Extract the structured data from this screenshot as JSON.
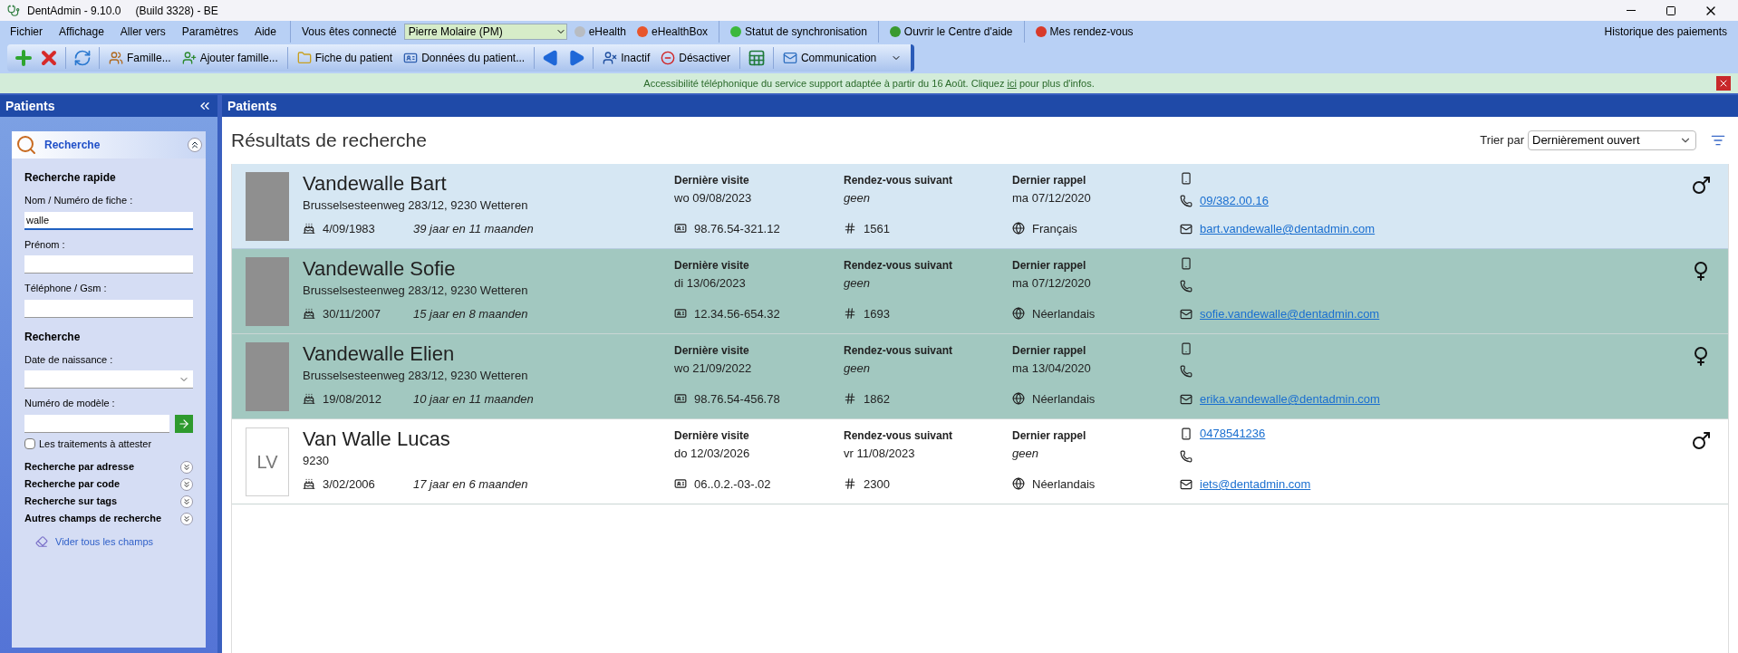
{
  "window": {
    "title": "DentAdmin - 9.10.0",
    "build": "(Build 3328) - BE"
  },
  "menu": {
    "items": [
      "Fichier",
      "Affichage",
      "Aller vers",
      "Paramètres",
      "Aide"
    ],
    "user_label": "Vous êtes connecté",
    "user": "Pierre Molaire (PM)",
    "status": [
      {
        "label": "eHealth",
        "color": "#b8bcc2"
      },
      {
        "label": "eHealthBox",
        "color": "#e8552c"
      },
      {
        "label": "Statut de synchronisation",
        "color": "#3cb83c"
      },
      {
        "label": "Ouvrir le Centre d'aide",
        "color": "#3a9a30"
      },
      {
        "label": "Mes rendez-vous",
        "color": "#d83a2a"
      }
    ],
    "right": "Historique des paiements"
  },
  "toolbar": {
    "buttons": [
      "Famille...",
      "Ajouter famille...",
      "Fiche du patient",
      "Données du patient...",
      "Inactif",
      "Désactiver",
      "Communication"
    ]
  },
  "notice": {
    "before": "Accessibilité téléphonique du service support adaptée à partir du 16 Août. Cliquez ",
    "link": "ici",
    "after": " pour plus d'infos."
  },
  "sidebar": {
    "title": "Patients",
    "section": {
      "title": "Recherche",
      "expanded": true
    },
    "quick_heading": "Recherche rapide",
    "quick_fields": [
      {
        "label": "Nom / Numéro de fiche :",
        "value": "walle",
        "focused": true
      },
      {
        "label": "Prénom :",
        "focused": false
      },
      {
        "label": "Téléphone / Gsm :",
        "focused": false
      }
    ],
    "search_heading": "Recherche",
    "birth_label": "Date de naissance :",
    "model_label": "Numéro de modèle :",
    "checkbox": {
      "label": "Les traitements à attester",
      "checked": false
    },
    "collapsed": [
      {
        "label": "Recherche par adresse",
        "expanded": false
      },
      {
        "label": "Recherche par code",
        "expanded": false
      },
      {
        "label": "Recherche sur tags",
        "expanded": false
      },
      {
        "label": "Autres champs de recherche",
        "expanded": false
      }
    ],
    "clear_link": "Vider tous les champs"
  },
  "main": {
    "header": "Patients",
    "title": "Résultats de recherche",
    "sort_label": "Trier par",
    "sort_value": "Dernièrement ouvert"
  },
  "patients": [
    {
      "name": "Vandewalle Bart",
      "address": "Brusselsesteenweg 283/12, 9230 Wetteren",
      "birth": "4/09/1983",
      "age": "39 jaar en 11 maanden",
      "avatar": {
        "kind": "photo"
      },
      "selected": true,
      "highlighted": false,
      "visit_label": "Dernière visite",
      "visit": "wo 09/08/2023",
      "appt_label": "Rendez-vous suivant",
      "appt": "geen",
      "appt_none": true,
      "recall_label": "Dernier rappel",
      "recall": "ma 07/12/2020",
      "recall_none": false,
      "national_id": "98.76.54-321.12",
      "file": "1561",
      "language": "Français",
      "phone": "09/382.00.16",
      "email": "bart.vandewalle@dentadmin.com",
      "male": true
    },
    {
      "name": "Vandewalle Sofie",
      "address": "Brusselsesteenweg 283/12, 9230 Wetteren",
      "birth": "30/11/2007",
      "age": "15 jaar en 8 maanden",
      "avatar": {
        "kind": "photo"
      },
      "selected": false,
      "highlighted": true,
      "visit_label": "Dernière visite",
      "visit": "di 13/06/2023",
      "appt_label": "Rendez-vous suivant",
      "appt": "geen",
      "appt_none": true,
      "recall_label": "Dernier rappel",
      "recall": "ma 07/12/2020",
      "recall_none": false,
      "national_id": "12.34.56-654.32",
      "file": "1693",
      "language": "Néerlandais",
      "email": "sofie.vandewalle@dentadmin.com",
      "male": false
    },
    {
      "name": "Vandewalle Elien",
      "address": "Brusselsesteenweg 283/12, 9230 Wetteren",
      "birth": "19/08/2012",
      "age": "10 jaar en 11 maanden",
      "avatar": {
        "kind": "photo"
      },
      "selected": false,
      "highlighted": true,
      "visit_label": "Dernière visite",
      "visit": "wo 21/09/2022",
      "appt_label": "Rendez-vous suivant",
      "appt": "geen",
      "appt_none": true,
      "recall_label": "Dernier rappel",
      "recall": "ma 13/04/2020",
      "recall_none": false,
      "national_id": "98.76.54-456.78",
      "file": "1862",
      "language": "Néerlandais",
      "email": "erika.vandewalle@dentadmin.com",
      "male": false
    },
    {
      "name": "Van Walle Lucas",
      "address": "9230",
      "birth": "3/02/2006",
      "age": "17 jaar en 6 maanden",
      "avatar": {
        "kind": "initials",
        "text": "LV"
      },
      "selected": false,
      "highlighted": false,
      "visit_label": "Dernière visite",
      "visit": "do 12/03/2026",
      "appt_label": "Rendez-vous suivant",
      "appt": "vr 11/08/2023",
      "appt_none": false,
      "recall_label": "Dernier rappel",
      "recall": "geen",
      "recall_none": true,
      "national_id": "06..0.2.-03-.02",
      "file": "2300",
      "language": "Néerlandais",
      "mobile": "0478541236",
      "email": "iets@dentadmin.com",
      "male": true
    }
  ]
}
